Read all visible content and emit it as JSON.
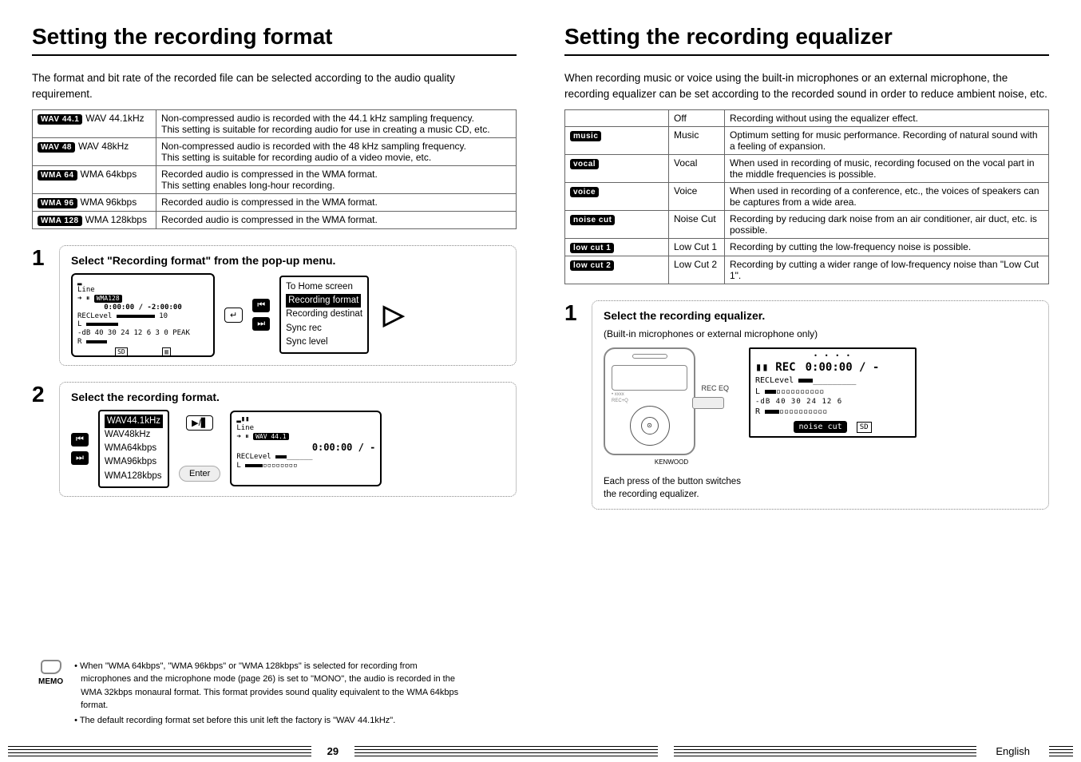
{
  "left": {
    "heading": "Setting the recording format",
    "intro": "The format and bit rate of the recorded file can be selected according to the audio quality requirement.",
    "formats": [
      {
        "chip": "WAV 44.1",
        "label": "WAV 44.1kHz",
        "desc": "Non-compressed audio is recorded with the 44.1 kHz sampling frequency.\nThis setting is suitable for recording audio for use in creating a music CD, etc."
      },
      {
        "chip": "WAV 48",
        "label": "WAV 48kHz",
        "desc": "Non-compressed audio is recorded with the 48 kHz sampling frequency.\nThis setting is suitable for recording audio of a video movie, etc."
      },
      {
        "chip": "WMA 64",
        "label": "WMA 64kbps",
        "desc": "Recorded audio is compressed in the WMA format.\nThis setting enables long-hour recording."
      },
      {
        "chip": "WMA 96",
        "label": "WMA 96kbps",
        "desc": "Recorded audio is compressed in the WMA format."
      },
      {
        "chip": "WMA 128",
        "label": "WMA 128kbps",
        "desc": "Recorded audio is compressed in the WMA format."
      }
    ],
    "step1": {
      "title": "Select \"Recording format\" from the pop-up menu.",
      "lcd": {
        "line1": "Line",
        "chip": "WMA128",
        "time": "0:00:00 / -2:00:00",
        "rec": "RECLevel",
        "level": "10",
        "scale": "-dB 40 30 24   12 6 3 0 PEAK",
        "sd": "SD"
      },
      "buttons": {
        "enter": "↵",
        "back": "⏮",
        "next": "⏭"
      },
      "menu": {
        "item0": "To Home screen",
        "item1": "Recording format",
        "item2": "Recording destinat",
        "item3": "Sync rec",
        "item4": "Sync level"
      },
      "big_arrow": "▷"
    },
    "step2": {
      "title": "Select the recording format.",
      "options": {
        "o0": "WAV44.1kHz",
        "o1": "WAV48kHz",
        "o2": "WMA64kbps",
        "o3": "WMA96kbps",
        "o4": "WMA128kbps"
      },
      "buttons": {
        "back": "⏮",
        "next": "⏭",
        "play": "▶/▋",
        "enter": "Enter"
      },
      "lcd": {
        "line1": "Line",
        "chip": "WAV 44.1",
        "time": "0:00:00 / -",
        "rec": "RECLevel"
      }
    },
    "memo": {
      "label": "MEMO",
      "items": [
        "When \"WMA 64kbps\", \"WMA 96kbps\" or \"WMA 128kbps\" is selected for recording from microphones and the microphone mode (page 26) is set to \"MONO\", the audio is recorded in the WMA 32kbps monaural format. This format provides sound quality equivalent to the WMA 64kbps format.",
        "The default recording format set before this unit left the factory is \"WAV 44.1kHz\"."
      ]
    }
  },
  "right": {
    "heading": "Setting the recording equalizer",
    "intro": "When recording music or voice using the built-in microphones or an external microphone, the recording equalizer can be set according to the recorded sound in order to reduce ambient noise, etc.",
    "eq": [
      {
        "chip": "",
        "label": "Off",
        "desc": "Recording without using the equalizer effect."
      },
      {
        "chip": "music",
        "label": "Music",
        "desc": "Optimum setting for music performance. Recording of natural sound with a feeling of expansion."
      },
      {
        "chip": "vocal",
        "label": "Vocal",
        "desc": "When used in recording of music, recording focused on the vocal part in the middle frequencies is possible."
      },
      {
        "chip": "voice",
        "label": "Voice",
        "desc": "When used in recording of a conference, etc., the voices of speakers can be captures from a wide area."
      },
      {
        "chip": "noise cut",
        "label": "Noise Cut",
        "desc": "Recording by reducing dark noise from an air conditioner, air duct, etc. is possible."
      },
      {
        "chip": "low cut 1",
        "label": "Low Cut 1",
        "desc": "Recording by cutting the low-frequency noise is possible."
      },
      {
        "chip": "low cut 2",
        "label": "Low Cut 2",
        "desc": "Recording by cutting a wider range of low-frequency noise than \"Low Cut 1\"."
      }
    ],
    "step1": {
      "title": "Select the recording equalizer.",
      "sub": "(Built-in microphones or external microphone only)",
      "device": {
        "brand": "KENWOOD",
        "rec_eq": "REC EQ"
      },
      "lcd": {
        "state": "▮▮ REC",
        "time": "0:00:00 / -",
        "rec": "RECLevel",
        "scale": "-dB 40 30 24        12  6",
        "chip": "noise cut",
        "sd": "SD"
      },
      "caption": "Each press of the button switches the recording equalizer."
    }
  },
  "footer": {
    "page": "29",
    "lang": "English"
  }
}
